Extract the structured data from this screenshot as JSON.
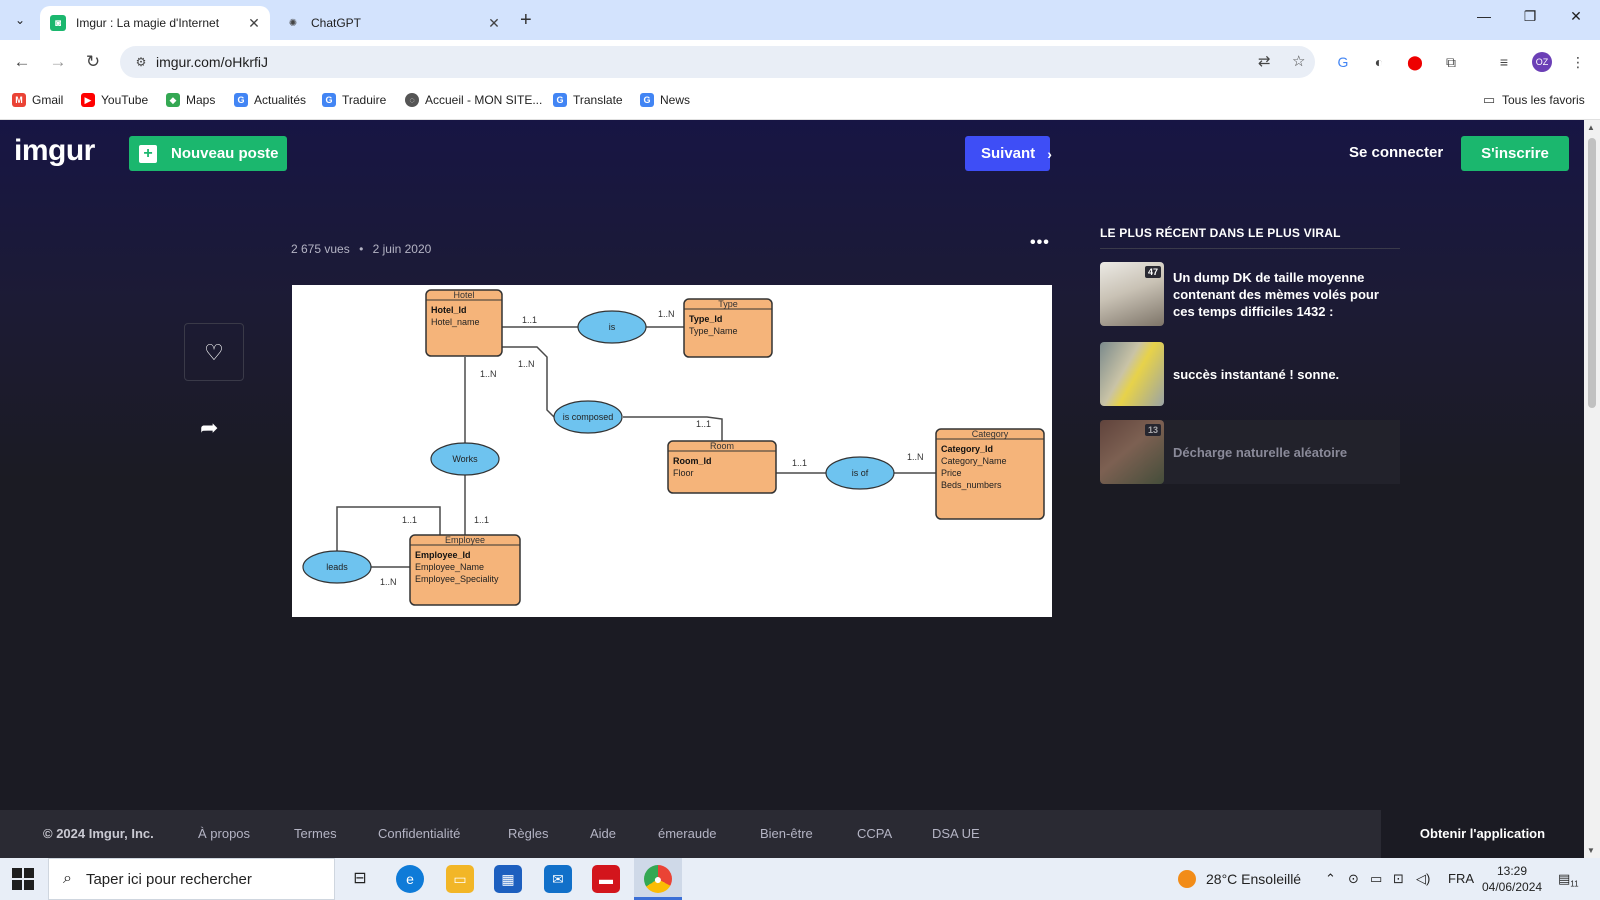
{
  "browser": {
    "tabs": [
      {
        "label": "Imgur : La magie d'Internet",
        "active": true
      },
      {
        "label": "ChatGPT",
        "active": false
      }
    ],
    "url": "imgur.com/oHkrfiJ",
    "bookmarks": [
      {
        "label": "Gmail",
        "color": "#ea4335"
      },
      {
        "label": "YouTube",
        "color": "#ff0000"
      },
      {
        "label": "Maps",
        "color": "#34a853"
      },
      {
        "label": "Actualités",
        "color": "#4285f4"
      },
      {
        "label": "Traduire",
        "color": "#4285f4"
      },
      {
        "label": "Accueil - MON SITE...",
        "color": "#555555"
      },
      {
        "label": "Translate",
        "color": "#4285f4"
      },
      {
        "label": "News",
        "color": "#4285f4"
      }
    ],
    "all_bookmarks": "Tous les favoris"
  },
  "imgur": {
    "logo": "imgur",
    "new_post": "Nouveau poste",
    "next": "Suivant",
    "login": "Se connecter",
    "signup": "S'inscrire",
    "views": "2 675 vues",
    "separator": "•",
    "date": "2 juin 2020",
    "viral_heading": "LE PLUS RÉCENT DANS LE PLUS VIRAL",
    "viral_posts": [
      {
        "title": "Un dump DK de taille moyenne contenant des mèmes volés pour ces temps difficiles 1432 :",
        "badge": "47"
      },
      {
        "title": "succès instantané ! sonne.",
        "badge": ""
      },
      {
        "title": "Décharge naturelle aléatoire",
        "badge": "13"
      }
    ],
    "footer": {
      "copyright": "© 2024 Imgur, Inc.",
      "links": [
        "À propos",
        "Termes",
        "Confidentialité",
        "Règles",
        "Aide",
        "émeraude",
        "Bien-être",
        "CCPA",
        "DSA UE"
      ],
      "get_app": "Obtenir l'application"
    }
  },
  "diagram": {
    "entities": {
      "hotel": {
        "title": "Hotel",
        "key": "Hotel_Id",
        "attrs": [
          "Hotel_name"
        ]
      },
      "type": {
        "title": "Type",
        "key": "Type_Id",
        "attrs": [
          "Type_Name"
        ]
      },
      "room": {
        "title": "Room",
        "key": "Room_Id",
        "attrs": [
          "Floor"
        ]
      },
      "category": {
        "title": "Category",
        "key": "Category_Id",
        "attrs": [
          "Category_Name",
          "Price",
          "Beds_numbers"
        ]
      },
      "employee": {
        "title": "Employee",
        "key": "Employee_Id",
        "attrs": [
          "Employee_Name",
          "Employee_Speciality"
        ]
      }
    },
    "relations": {
      "is": "is",
      "is_composed": "is composed",
      "works": "Works",
      "is_of": "is of",
      "leads": "leads"
    },
    "cardinalities": {
      "hotel_is": "1..1",
      "is_type": "1..N",
      "hotel_composed": "1..N",
      "composed_room": "1..1",
      "hotel_works": "1..N",
      "works_employee": "1..1",
      "room_isof": "1..1",
      "isof_category": "1..N",
      "leads_top": "1..1",
      "leads_bottom": "1..N"
    },
    "colors": {
      "entity": "#f5b47a",
      "relation": "#6ec3ef"
    }
  },
  "taskbar": {
    "search_placeholder": "Taper ici pour rechercher",
    "weather": "28°C  Ensoleillé",
    "lang": "FRA",
    "time": "13:29",
    "date": "04/06/2024",
    "notif_count": "11"
  }
}
